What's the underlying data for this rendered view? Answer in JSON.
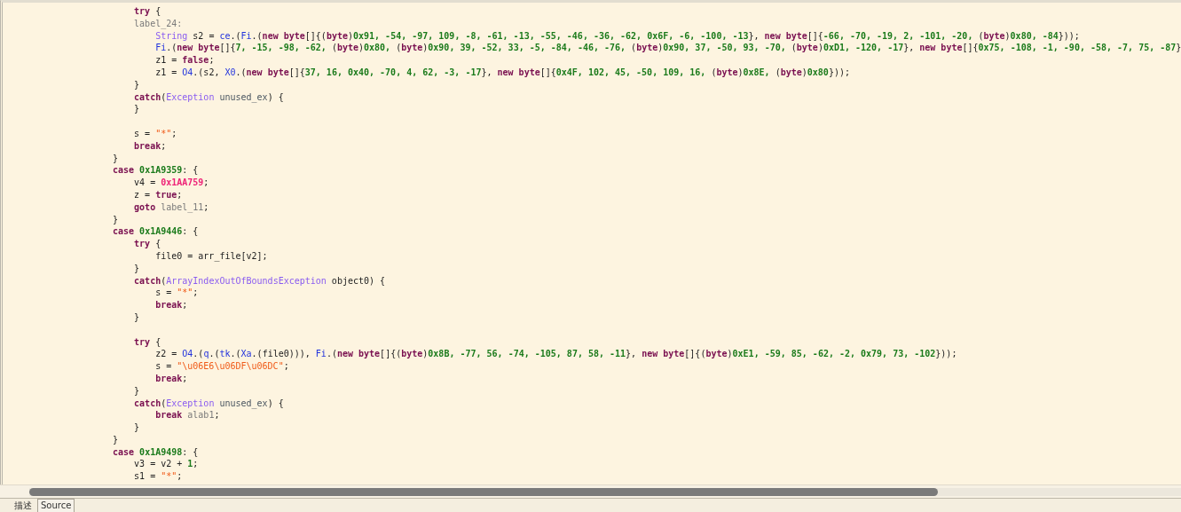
{
  "editor": {
    "lines": [
      {
        "kind": "code",
        "tokens": [
          {
            "kind": "keyword",
            "text": "    try"
          },
          {
            "kind": "plain",
            "text": " {"
          }
        ]
      },
      {
        "kind": "code",
        "tokens": [
          {
            "kind": "label",
            "text": "    label_24:"
          }
        ]
      },
      {
        "kind": "code",
        "tokens": [
          {
            "kind": "type",
            "text": "        String"
          },
          {
            "kind": "plain",
            "text": " s2 = "
          },
          {
            "kind": "class",
            "text": "ce"
          },
          {
            "kind": "plain",
            "text": ".("
          },
          {
            "kind": "class",
            "text": "Fi"
          },
          {
            "kind": "plain",
            "text": ".("
          },
          {
            "kind": "keyword",
            "text": "new byte"
          },
          {
            "kind": "plain",
            "text": "[]{("
          },
          {
            "kind": "keyword",
            "text": "byte"
          },
          {
            "kind": "plain",
            "text": ")"
          },
          {
            "kind": "number",
            "text": "0x91, -54, -97, 109, -8, -61, -13, -55, -46, -36, -62, 0x6F, -6, -100, -13"
          },
          {
            "kind": "plain",
            "text": "}, "
          },
          {
            "kind": "keyword",
            "text": "new byte"
          },
          {
            "kind": "plain",
            "text": "[]{"
          },
          {
            "kind": "number",
            "text": "-66, -70, -19, 2, -101, -20, "
          },
          {
            "kind": "plain",
            "text": "("
          },
          {
            "kind": "keyword",
            "text": "byte"
          },
          {
            "kind": "plain",
            "text": ")"
          },
          {
            "kind": "number",
            "text": "0x80, -84"
          },
          {
            "kind": "plain",
            "text": "}));"
          }
        ]
      },
      {
        "kind": "code",
        "tokens": [
          {
            "kind": "class",
            "text": "        Fi"
          },
          {
            "kind": "plain",
            "text": ".("
          },
          {
            "kind": "keyword",
            "text": "new byte"
          },
          {
            "kind": "plain",
            "text": "[]{"
          },
          {
            "kind": "number",
            "text": "7, -15, -98, -62, "
          },
          {
            "kind": "plain",
            "text": "("
          },
          {
            "kind": "keyword",
            "text": "byte"
          },
          {
            "kind": "plain",
            "text": ")"
          },
          {
            "kind": "number",
            "text": "0x80, "
          },
          {
            "kind": "plain",
            "text": "("
          },
          {
            "kind": "keyword",
            "text": "byte"
          },
          {
            "kind": "plain",
            "text": ")"
          },
          {
            "kind": "number",
            "text": "0x90, 39, -52, 33, -5, -84, -46, -76, "
          },
          {
            "kind": "plain",
            "text": "("
          },
          {
            "kind": "keyword",
            "text": "byte"
          },
          {
            "kind": "plain",
            "text": ")"
          },
          {
            "kind": "number",
            "text": "0x90, 37, -50, 93, -70, "
          },
          {
            "kind": "plain",
            "text": "("
          },
          {
            "kind": "keyword",
            "text": "byte"
          },
          {
            "kind": "plain",
            "text": ")"
          },
          {
            "kind": "number",
            "text": "0xD1, -120, -17"
          },
          {
            "kind": "plain",
            "text": "}, "
          },
          {
            "kind": "keyword",
            "text": "new byte"
          },
          {
            "kind": "plain",
            "text": "[]{"
          },
          {
            "kind": "number",
            "text": "0x75, -108, -1, -90, -58, -7, 75, -87"
          },
          {
            "kind": "plain",
            "text": "}"
          }
        ]
      },
      {
        "kind": "code",
        "tokens": [
          {
            "kind": "plain",
            "text": "        z1 = "
          },
          {
            "kind": "keyword",
            "text": "false"
          },
          {
            "kind": "plain",
            "text": ";"
          }
        ]
      },
      {
        "kind": "code",
        "tokens": [
          {
            "kind": "plain",
            "text": "        z1 = "
          },
          {
            "kind": "class",
            "text": "O4"
          },
          {
            "kind": "plain",
            "text": ".(s2, "
          },
          {
            "kind": "class",
            "text": "X0"
          },
          {
            "kind": "plain",
            "text": ".("
          },
          {
            "kind": "keyword",
            "text": "new byte"
          },
          {
            "kind": "plain",
            "text": "[]{"
          },
          {
            "kind": "number",
            "text": "37, 16, 0x40, -70, 4, 62, -3, -17"
          },
          {
            "kind": "plain",
            "text": "}, "
          },
          {
            "kind": "keyword",
            "text": "new byte"
          },
          {
            "kind": "plain",
            "text": "[]{"
          },
          {
            "kind": "number",
            "text": "0x4F, 102, 45, -50, 109, 16, "
          },
          {
            "kind": "plain",
            "text": "("
          },
          {
            "kind": "keyword",
            "text": "byte"
          },
          {
            "kind": "plain",
            "text": ")"
          },
          {
            "kind": "number",
            "text": "0x8E, "
          },
          {
            "kind": "plain",
            "text": "("
          },
          {
            "kind": "keyword",
            "text": "byte"
          },
          {
            "kind": "plain",
            "text": ")"
          },
          {
            "kind": "number",
            "text": "0x80"
          },
          {
            "kind": "plain",
            "text": "}));"
          }
        ]
      },
      {
        "kind": "code",
        "tokens": [
          {
            "kind": "plain",
            "text": "    }"
          }
        ]
      },
      {
        "kind": "code",
        "tokens": [
          {
            "kind": "keyword",
            "text": "    catch"
          },
          {
            "kind": "plain",
            "text": "("
          },
          {
            "kind": "type",
            "text": "Exception"
          },
          {
            "kind": "variable",
            "text": " unused_ex"
          },
          {
            "kind": "plain",
            "text": ") {"
          }
        ]
      },
      {
        "kind": "code",
        "tokens": [
          {
            "kind": "plain",
            "text": "    }"
          }
        ]
      },
      {
        "kind": "blank"
      },
      {
        "kind": "code",
        "tokens": [
          {
            "kind": "plain",
            "text": "    s = "
          },
          {
            "kind": "string",
            "text": "\"*\""
          },
          {
            "kind": "plain",
            "text": ";"
          }
        ]
      },
      {
        "kind": "code",
        "tokens": [
          {
            "kind": "keyword",
            "text": "    break"
          },
          {
            "kind": "plain",
            "text": ";"
          }
        ]
      },
      {
        "kind": "code",
        "tokens": [
          {
            "kind": "plain",
            "text": "}"
          }
        ]
      },
      {
        "kind": "code",
        "tokens": [
          {
            "kind": "keyword",
            "text": "case"
          },
          {
            "kind": "number",
            "text": " 0x1A9359"
          },
          {
            "kind": "plain",
            "text": ": {"
          }
        ]
      },
      {
        "kind": "code",
        "tokens": [
          {
            "kind": "plain",
            "text": "    v4 = "
          },
          {
            "kind": "constant",
            "text": "0x1AA759"
          },
          {
            "kind": "plain",
            "text": ";"
          }
        ]
      },
      {
        "kind": "code",
        "tokens": [
          {
            "kind": "plain",
            "text": "    z = "
          },
          {
            "kind": "keyword",
            "text": "true"
          },
          {
            "kind": "plain",
            "text": ";"
          }
        ]
      },
      {
        "kind": "code",
        "tokens": [
          {
            "kind": "keyword",
            "text": "    goto"
          },
          {
            "kind": "label",
            "text": " label_11"
          },
          {
            "kind": "plain",
            "text": ";"
          }
        ]
      },
      {
        "kind": "code",
        "tokens": [
          {
            "kind": "plain",
            "text": "}"
          }
        ]
      },
      {
        "kind": "code",
        "tokens": [
          {
            "kind": "keyword",
            "text": "case"
          },
          {
            "kind": "number",
            "text": " 0x1A9446"
          },
          {
            "kind": "plain",
            "text": ": {"
          }
        ]
      },
      {
        "kind": "code",
        "tokens": [
          {
            "kind": "keyword",
            "text": "    try"
          },
          {
            "kind": "plain",
            "text": " {"
          }
        ]
      },
      {
        "kind": "code",
        "tokens": [
          {
            "kind": "plain",
            "text": "        file0 = arr_file[v2];"
          }
        ]
      },
      {
        "kind": "code",
        "tokens": [
          {
            "kind": "plain",
            "text": "    }"
          }
        ]
      },
      {
        "kind": "code",
        "tokens": [
          {
            "kind": "keyword",
            "text": "    catch"
          },
          {
            "kind": "plain",
            "text": "("
          },
          {
            "kind": "type",
            "text": "ArrayIndexOutOfBoundsException"
          },
          {
            "kind": "plain",
            "text": " object0) {"
          }
        ]
      },
      {
        "kind": "code",
        "tokens": [
          {
            "kind": "plain",
            "text": "        s = "
          },
          {
            "kind": "string",
            "text": "\"*\""
          },
          {
            "kind": "plain",
            "text": ";"
          }
        ]
      },
      {
        "kind": "code",
        "tokens": [
          {
            "kind": "keyword",
            "text": "        break"
          },
          {
            "kind": "plain",
            "text": ";"
          }
        ]
      },
      {
        "kind": "code",
        "tokens": [
          {
            "kind": "plain",
            "text": "    }"
          }
        ]
      },
      {
        "kind": "blank"
      },
      {
        "kind": "code",
        "tokens": [
          {
            "kind": "keyword",
            "text": "    try"
          },
          {
            "kind": "plain",
            "text": " {"
          }
        ]
      },
      {
        "kind": "code",
        "tokens": [
          {
            "kind": "plain",
            "text": "        z2 = "
          },
          {
            "kind": "class",
            "text": "O4"
          },
          {
            "kind": "plain",
            "text": ".("
          },
          {
            "kind": "class",
            "text": "q"
          },
          {
            "kind": "plain",
            "text": ".("
          },
          {
            "kind": "class",
            "text": "tk"
          },
          {
            "kind": "plain",
            "text": ".("
          },
          {
            "kind": "class",
            "text": "Xa"
          },
          {
            "kind": "plain",
            "text": ".(file0))), "
          },
          {
            "kind": "class",
            "text": "Fi"
          },
          {
            "kind": "plain",
            "text": ".("
          },
          {
            "kind": "keyword",
            "text": "new byte"
          },
          {
            "kind": "plain",
            "text": "[]{("
          },
          {
            "kind": "keyword",
            "text": "byte"
          },
          {
            "kind": "plain",
            "text": ")"
          },
          {
            "kind": "number",
            "text": "0x8B, -77, 56, -74, -105, 87, 58, -11"
          },
          {
            "kind": "plain",
            "text": "}, "
          },
          {
            "kind": "keyword",
            "text": "new byte"
          },
          {
            "kind": "plain",
            "text": "[]{("
          },
          {
            "kind": "keyword",
            "text": "byte"
          },
          {
            "kind": "plain",
            "text": ")"
          },
          {
            "kind": "number",
            "text": "0xE1, -59, 85, -62, -2, 0x79, 73, -102"
          },
          {
            "kind": "plain",
            "text": "}));"
          }
        ]
      },
      {
        "kind": "code",
        "tokens": [
          {
            "kind": "plain",
            "text": "        s = "
          },
          {
            "kind": "string",
            "text": "\"\\u06E6\\u06DF\\u06DC\""
          },
          {
            "kind": "plain",
            "text": ";"
          }
        ]
      },
      {
        "kind": "code",
        "tokens": [
          {
            "kind": "keyword",
            "text": "        break"
          },
          {
            "kind": "plain",
            "text": ";"
          }
        ]
      },
      {
        "kind": "code",
        "tokens": [
          {
            "kind": "plain",
            "text": "    }"
          }
        ]
      },
      {
        "kind": "code",
        "tokens": [
          {
            "kind": "keyword",
            "text": "    catch"
          },
          {
            "kind": "plain",
            "text": "("
          },
          {
            "kind": "type",
            "text": "Exception"
          },
          {
            "kind": "variable",
            "text": " unused_ex"
          },
          {
            "kind": "plain",
            "text": ") {"
          }
        ]
      },
      {
        "kind": "code",
        "tokens": [
          {
            "kind": "keyword",
            "text": "        break"
          },
          {
            "kind": "label",
            "text": " alab1"
          },
          {
            "kind": "plain",
            "text": ";"
          }
        ]
      },
      {
        "kind": "code",
        "tokens": [
          {
            "kind": "plain",
            "text": "    }"
          }
        ]
      },
      {
        "kind": "code",
        "tokens": [
          {
            "kind": "plain",
            "text": "}"
          }
        ]
      },
      {
        "kind": "code",
        "tokens": [
          {
            "kind": "keyword",
            "text": "case"
          },
          {
            "kind": "number",
            "text": " 0x1A9498"
          },
          {
            "kind": "plain",
            "text": ": {"
          }
        ]
      },
      {
        "kind": "code",
        "tokens": [
          {
            "kind": "plain",
            "text": "    v3 = v2 + "
          },
          {
            "kind": "number",
            "text": "1"
          },
          {
            "kind": "plain",
            "text": ";"
          }
        ]
      },
      {
        "kind": "code",
        "tokens": [
          {
            "kind": "plain",
            "text": "    s1 = "
          },
          {
            "kind": "string",
            "text": "\"*\""
          },
          {
            "kind": "plain",
            "text": ";"
          }
        ]
      }
    ]
  },
  "bottom_tabs": [
    {
      "label": "描述",
      "selected": false
    },
    {
      "label": "Source",
      "selected": true
    }
  ]
}
